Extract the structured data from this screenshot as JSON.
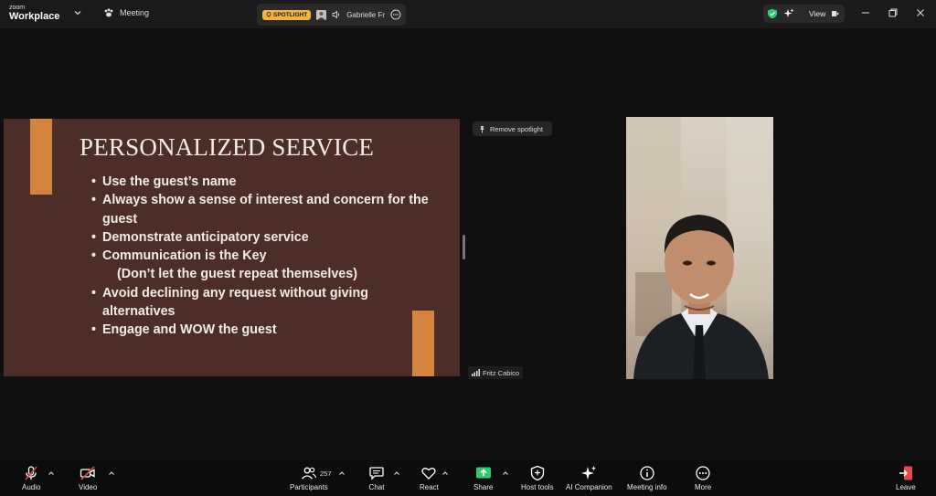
{
  "titlebar": {
    "logo_small": "zoom",
    "logo_big": "Workplace",
    "meeting_label": "Meeting",
    "spotlight_tag": "SPOTLIGHT",
    "speaker_name": "Gabrielle Fr",
    "view_label": "View"
  },
  "stage": {
    "remove_spotlight": "Remove spotlight",
    "participant_name": "Fritz Cabico",
    "slide": {
      "title": "PERSONALIZED SERVICE",
      "bullets": [
        "Use the guest’s name",
        "Always show a sense of interest and concern for the guest",
        "Demonstrate anticipatory service",
        "Communication is the Key",
        "(Don’t let the guest repeat themselves)",
        "Avoid declining any request without giving alternatives",
        "Engage and WOW the guest"
      ]
    }
  },
  "toolbar": {
    "audio": "Audio",
    "video": "Video",
    "participants": "Participants",
    "participants_count": "257",
    "chat": "Chat",
    "react": "React",
    "share": "Share",
    "host_tools": "Host tools",
    "ai_companion": "AI Companion",
    "meeting_info": "Meeting info",
    "more": "More",
    "leave": "Leave"
  },
  "colors": {
    "slide_bg": "#4d2d27",
    "slide_accent": "#d4843e",
    "spotlight_tag": "#f2b43c",
    "share_green": "#2ecc71",
    "mute_red": "#e5484d"
  }
}
